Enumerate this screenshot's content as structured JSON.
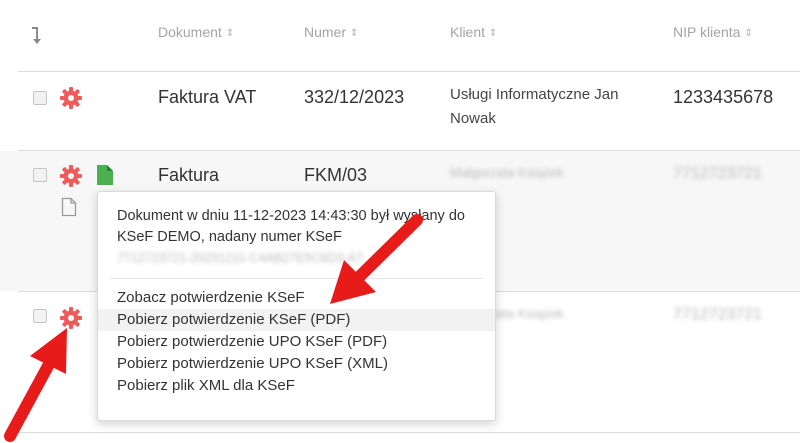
{
  "table": {
    "headers": [
      "Dokument",
      "Numer",
      "Klient",
      "NIP klienta"
    ],
    "sort_glyph": "⇕"
  },
  "rows": [
    {
      "document": "Faktura VAT",
      "number": "332/12/2023",
      "client": "Usługi Informatyczne Jan Nowak",
      "nip": "1233435678"
    },
    {
      "document": "Faktura",
      "number": "FKM/03",
      "client": "Małgorzata Książek",
      "nip": "7712723721"
    },
    {
      "client": "Małgorzata Książek",
      "nip": "7712723721"
    }
  ],
  "menu": {
    "info_text": "Dokument w dniu 11-12-2023 14:43:30 był wysłany do KSeF DEMO, nadany numer KSeF",
    "ksef_number": "7712723721-20231211-C4AB27E5C6D3-A7",
    "items": [
      "Zobacz potwierdzenie KSeF",
      "Pobierz potwierdzenie KSeF (PDF)",
      "Pobierz potwierdzenie UPO KSeF (PDF)",
      "Pobierz potwierdzenie UPO KSeF (XML)",
      "Pobierz plik XML dla KSeF"
    ]
  },
  "colors": {
    "gear": "#f05a5a",
    "document_icon": "#4caf50",
    "arrow": "#e81b1b"
  },
  "icons": [
    "sort-arrow-icon",
    "gear-icon",
    "document-green-icon",
    "document-outline-icon",
    "red-arrow-icon"
  ]
}
